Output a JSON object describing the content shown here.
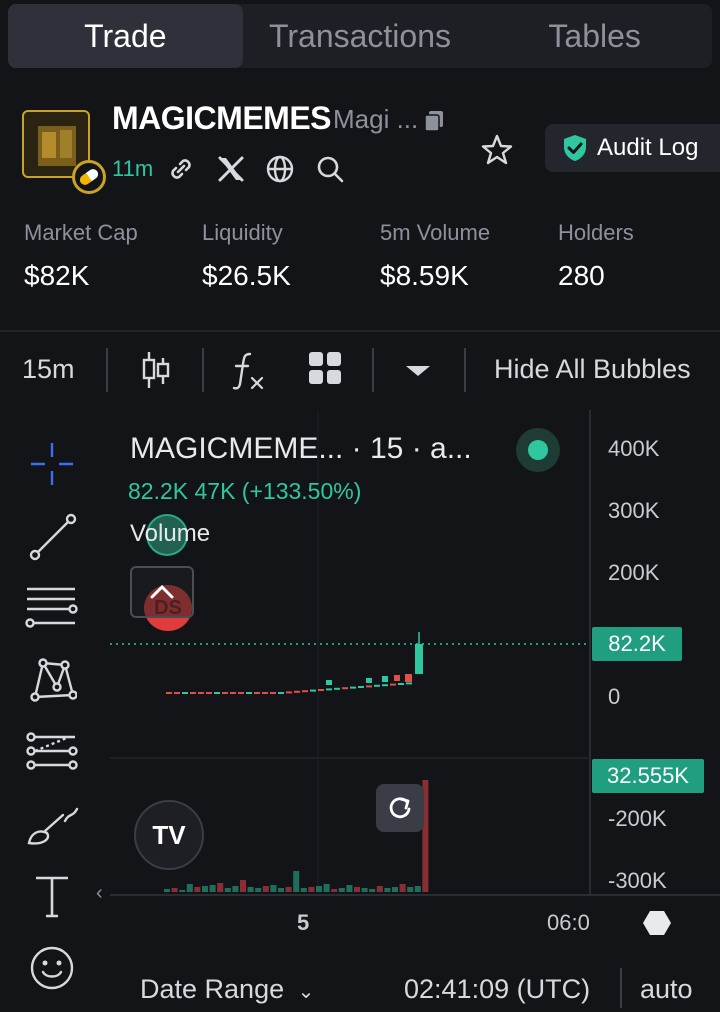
{
  "tabs": [
    {
      "label": "Trade",
      "active": true
    },
    {
      "label": "Transactions",
      "active": false
    },
    {
      "label": "Tables",
      "active": false
    }
  ],
  "token": {
    "name": "MAGICMEMES",
    "subname": "Magi ...",
    "age": "11m",
    "icons": [
      "link-icon",
      "x-icon",
      "globe-icon",
      "search-icon",
      "copy-icon",
      "star-icon",
      "shield-check-icon",
      "pill-icon"
    ]
  },
  "audit_button": {
    "label": "Audit Log"
  },
  "stats": [
    {
      "label": "Market Cap",
      "value": "$82K"
    },
    {
      "label": "Liquidity",
      "value": "$26.5K"
    },
    {
      "label": "5m Volume",
      "value": "$8.59K"
    },
    {
      "label": "Holders",
      "value": "280"
    }
  ],
  "toolbar": {
    "interval": "15m",
    "hide_bubbles": "Hide All Bubbles",
    "icons": [
      "candlestick-icon",
      "indicator-fx-icon",
      "grid-layout-icon",
      "dropdown-arrow-icon"
    ]
  },
  "tools": [
    "crosshair-icon",
    "trendline-icon",
    "horizontal-lines-icon",
    "pattern-icon",
    "fib-icon",
    "brush-icon",
    "text-icon",
    "emoji-icon"
  ],
  "chart": {
    "legend_name": "MAGICMEME... · 15 · a...",
    "legend_price": "82.2K  47K (+133.50%)",
    "volume_label": "Volume",
    "bubble_label": "DS",
    "price_tag": "82.2K",
    "volume_tag": "32.555K",
    "logo_text": "TV",
    "y_ticks": [
      "400K",
      "300K",
      "200K",
      "0",
      "-200K",
      "-300K"
    ],
    "x_ticks": [
      "5",
      "06:0"
    ],
    "colors": {
      "up": "#2fc7a0",
      "down": "#e14e4e",
      "tag": "#1f9e80"
    }
  },
  "bottom": {
    "date_range": "Date Range",
    "time": "02:41:09 (UTC)",
    "auto": "auto"
  }
}
